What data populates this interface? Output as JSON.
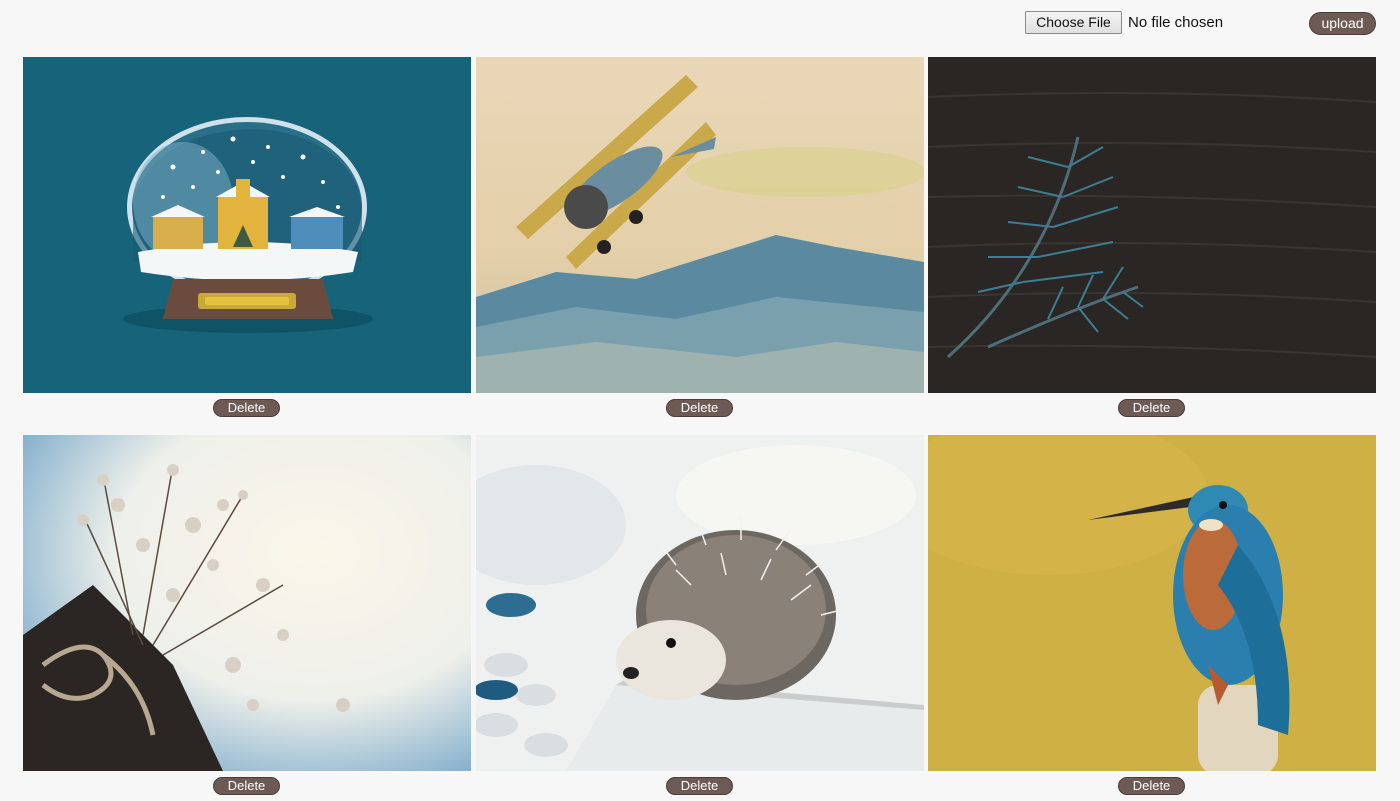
{
  "uploader": {
    "choose_file_label": "Choose File",
    "file_status": "No file chosen",
    "upload_label": "upload"
  },
  "gallery": {
    "items": [
      {
        "subject": "snow-globe",
        "delete_label": "Delete"
      },
      {
        "subject": "biplane",
        "delete_label": "Delete"
      },
      {
        "subject": "fern",
        "delete_label": "Delete"
      },
      {
        "subject": "flowers",
        "delete_label": "Delete"
      },
      {
        "subject": "hedgehog",
        "delete_label": "Delete"
      },
      {
        "subject": "kingfisher",
        "delete_label": "Delete"
      }
    ]
  },
  "colors": {
    "page_bg": "#f7f7f7",
    "button_bg": "#6d5a55",
    "button_text": "#ffffff"
  }
}
